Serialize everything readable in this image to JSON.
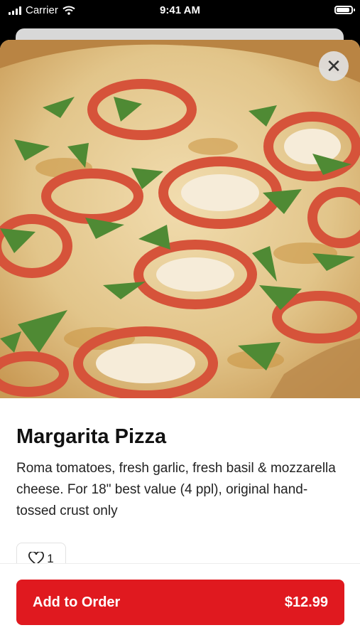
{
  "status_bar": {
    "carrier": "Carrier",
    "time": "9:41 AM",
    "battery_level": 0.9
  },
  "product": {
    "image_description_icon": "pizza-photo",
    "title": "Margarita Pizza",
    "description": "Roma tomatoes, fresh garlic, fresh basil & mozzarella cheese. For 18\" best value (4 ppl), original hand-tossed crust only",
    "likes": "1"
  },
  "actions": {
    "close_icon": "close-icon",
    "add_label": "Add to Order",
    "price": "$12.99",
    "accent_color": "#e0191f"
  }
}
